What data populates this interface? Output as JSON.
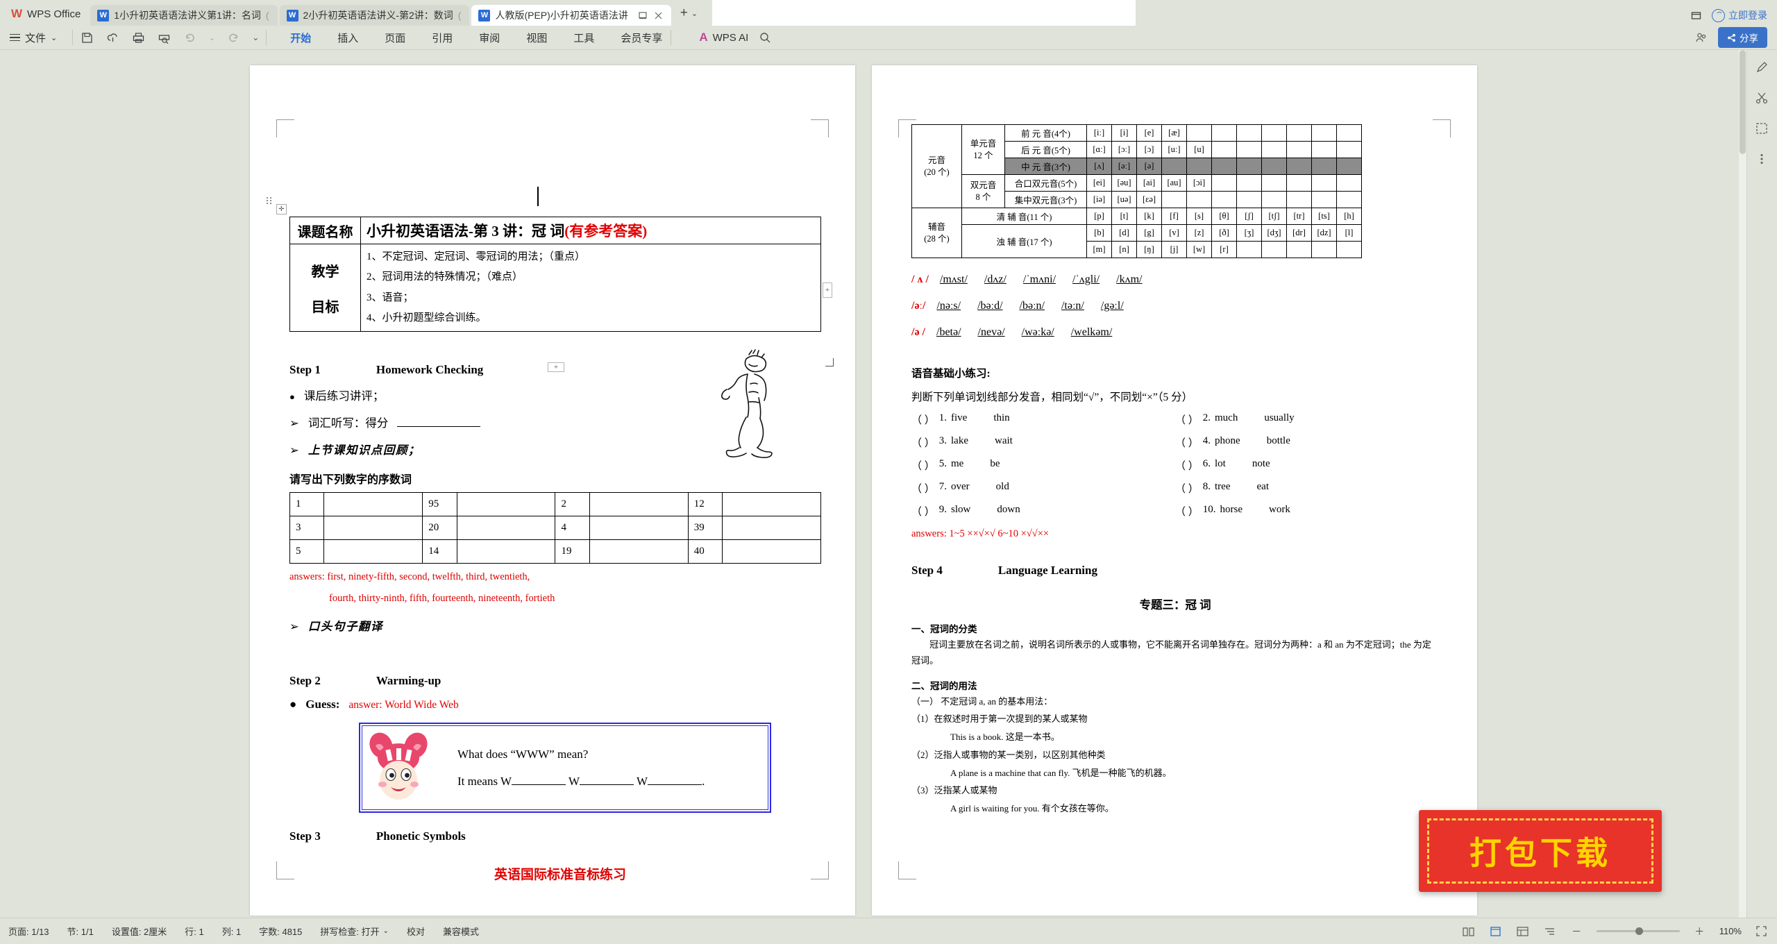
{
  "app": {
    "name": "WPS Office",
    "logo_letter": "W"
  },
  "titlebar": {
    "tabs": [
      {
        "label": "1小升初英语语法讲义第1讲：名词",
        "suffix": "(",
        "active": false
      },
      {
        "label": "2小升初英语语法讲义-第2讲：数词",
        "suffix": "(",
        "active": false
      },
      {
        "label": "人教版(PEP)小升初英语语法讲",
        "suffix": "",
        "active": true
      }
    ],
    "new_tab": "+",
    "new_tab_chevron": "⌄",
    "minimize_icon": "window-restore",
    "login_label": "立即登录"
  },
  "ribbon": {
    "file_menu": "文件",
    "file_chevron": "⌄",
    "quick_icons": [
      "save-icon",
      "cloud-save-icon",
      "print-icon",
      "print-preview-icon",
      "undo-icon",
      "undo-dropdown",
      "redo-icon",
      "quick-access-chevron"
    ],
    "tabs": [
      "开始",
      "插入",
      "页面",
      "引用",
      "审阅",
      "视图",
      "工具",
      "会员专享"
    ],
    "active_tab": "开始",
    "ai_label": "WPS AI",
    "search_icon": "search-icon",
    "share_label": "分享",
    "right_icons": [
      "collaborate-icon",
      "share-icon"
    ]
  },
  "document": {
    "left_page": {
      "title_table": {
        "row1_label": "课题名称",
        "row1_title": "小升初英语语法-第 3 讲：冠 词",
        "row1_title_red": "(有参考答案)",
        "row2_label_line1": "教学",
        "row2_label_line2": "目标",
        "objectives": [
          "1、不定冠词、定冠词、零冠词的用法；（重点）",
          "2、冠词用法的特殊情况；（难点）",
          "3、语音；",
          "4、小升初题型综合训练。"
        ]
      },
      "step1": {
        "label": "Step 1",
        "title": "Homework Checking",
        "bullet1": "课后练习讲评；",
        "arrow1": "词汇听写：得分",
        "arrow2": "上节课知识点回顾；",
        "section_title": "请写出下列数字的序数词",
        "table_rows": [
          [
            "1",
            "",
            "95",
            "",
            "2",
            "",
            "12",
            ""
          ],
          [
            "3",
            "",
            "20",
            "",
            "4",
            "",
            "39",
            ""
          ],
          [
            "5",
            "",
            "14",
            "",
            "19",
            "",
            "40",
            ""
          ]
        ],
        "answers_line1": "answers: first, ninety-fifth, second, twelfth, third, twentieth,",
        "answers_line2": "fourth, thirty-ninth, fifth, fourteenth, nineteenth, fortieth",
        "arrow3": "口头句子翻译"
      },
      "step2": {
        "label": "Step 2",
        "title": "Warming-up",
        "guess_label": "Guess:",
        "guess_answer": "answer: World Wide Web",
        "box_line1": "What does “WWW” mean?",
        "box_line2_pre": "It means W",
        "box_line2_mid1": "W",
        "box_line2_mid2": "W",
        "box_line2_end": "."
      },
      "step3": {
        "label": "Step 3",
        "title": "Phonetic Symbols",
        "red_title": "英语国际标准音标练习"
      }
    },
    "right_page": {
      "phonetic_table": {
        "rows": [
          {
            "group": "元音\n(20 个)",
            "sub": "单元音\n12 个",
            "name": "前  元 音(4个)",
            "cells": [
              "[iː]",
              "[i]",
              "[e]",
              "[æ]",
              "",
              "",
              "",
              "",
              "",
              "",
              ""
            ],
            "shade": false
          },
          {
            "group": "",
            "sub": "",
            "name": "后  元 音(5个)",
            "cells": [
              "[ɑː]",
              "[ɔː]",
              "[ɔ]",
              "[uː]",
              "[u]",
              "",
              "",
              "",
              "",
              "",
              ""
            ],
            "shade": false
          },
          {
            "group": "",
            "sub": "",
            "name": "中  元 音(3个)",
            "cells": [
              "[ʌ]",
              "[əː]",
              "[ə]",
              "",
              "",
              "",
              "",
              "",
              "",
              "",
              ""
            ],
            "shade": true
          },
          {
            "group": "",
            "sub": "双元音\n8 个",
            "name": "合口双元音(5个)",
            "cells": [
              "[ei]",
              "[əu]",
              "[ai]",
              "[au]",
              "[ɔi]",
              "",
              "",
              "",
              "",
              "",
              ""
            ],
            "shade": false
          },
          {
            "group": "",
            "sub": "",
            "name": "集中双元音(3个)",
            "cells": [
              "[iə]",
              "[uə]",
              "[ɛə]",
              "",
              "",
              "",
              "",
              "",
              "",
              "",
              ""
            ],
            "shade": false
          },
          {
            "group": "辅音\n(28 个)",
            "sub": "",
            "name": "清  辅   音(11 个)",
            "cells": [
              "[p]",
              "[t]",
              "[k]",
              "[f]",
              "[s]",
              "[θ]",
              "[ʃ]",
              "[tʃ]",
              "[tr]",
              "[ts]",
              "[h]"
            ],
            "shade": false
          },
          {
            "group": "",
            "sub": "",
            "name": "浊  辅   音(17 个)",
            "cells": [
              "[b]",
              "[d]",
              "[g]",
              "[v]",
              "[z]",
              "[ð]",
              "[ʒ]",
              "[dʒ]",
              "[dr]",
              "[dz]",
              "[l]"
            ],
            "shade": false
          },
          {
            "group": "",
            "sub": "",
            "name": "",
            "cells": [
              "[m]",
              "[n]",
              "[ŋ]",
              "[j]",
              "[w]",
              "[r]",
              "",
              "",
              "",
              "",
              ""
            ],
            "shade": false
          }
        ],
        "labels": {
          "vowel_group": "元音",
          "vowel_count": "(20 个)",
          "mono": "单元音",
          "mono_count": "12 个",
          "diph": "双元音",
          "diph_count": "8 个",
          "cons_group": "辅音",
          "cons_count": "(28 个)"
        }
      },
      "ipa_rows": [
        {
          "key": "/ ʌ /",
          "words": [
            "/mʌst/",
            "/dʌz/",
            "/ˈmʌni/",
            "/ˈʌgli/",
            "/kʌm/"
          ]
        },
        {
          "key": "/əː/",
          "words": [
            "/nəːs/",
            "/bəːd/",
            "/bəːn/",
            "/təːn/",
            "/gəːl/"
          ]
        },
        {
          "key": "/ə /",
          "words": [
            "/betə/",
            "/nevə/",
            "/wəːkə/",
            "/welkəm/"
          ]
        }
      ],
      "practice": {
        "title": "语音基础小练习:",
        "instruction": "判断下列单词划线部分发音，相同划“√”，不同划“×”（5 分）",
        "items": [
          {
            "no": "1.",
            "w1": "five",
            "w1_u": "i",
            "w2": "thin",
            "w2_u": "i"
          },
          {
            "no": "2.",
            "w1": "much",
            "w1_u": "u",
            "w2": "usually",
            "w2_u": "u"
          },
          {
            "no": "3.",
            "w1": "lake",
            "w1_u": "a",
            "w2": "wait",
            "w2_u": "ai"
          },
          {
            "no": "4.",
            "w1": "phone",
            "w1_u": "o",
            "w2": "bottle",
            "w2_u": "o"
          },
          {
            "no": "5.",
            "w1": "me",
            "w1_u": "e",
            "w2": "be",
            "w2_u": "e"
          },
          {
            "no": "6.",
            "w1": "lot",
            "w1_u": "o",
            "w2": "note",
            "w2_u": "o"
          },
          {
            "no": "7.",
            "w1": "over",
            "w1_u": "o",
            "w2": "old",
            "w2_u": "o"
          },
          {
            "no": "8.",
            "w1": "tree",
            "w1_u": "ee",
            "w2": "eat",
            "w2_u": "ea"
          },
          {
            "no": "9.",
            "w1": "slow",
            "w1_u": "ow",
            "w2": "down",
            "w2_u": "ow"
          },
          {
            "no": "10.",
            "w1": "horse",
            "w1_u": "or",
            "w2": "work",
            "w2_u": "or"
          }
        ],
        "answers": "answers: 1~5 ××√×√      6~10 ×√√××",
        "paren": "（    ）"
      },
      "step4": {
        "label": "Step 4",
        "title": "Language Learning",
        "topic": "专题三：冠  词",
        "h1": "一、冠词的分类",
        "p1": "冠词主要放在名词之前，说明名词所表示的人或事物，它不能离开名词单独存在。冠词分为两种：a 和 an 为不定冠词；the 为定冠词。",
        "h2": "二、冠词的用法",
        "h2a": "（一） 不定冠词 a, an 的基本用法：",
        "p2": "（1）在叙述时用于第一次提到的某人或某物",
        "p2e": "This is a book. 这是一本书。",
        "p3": "（2）泛指人或事物的某一类别，以区别其他种类",
        "p3e": "A plane is a machine that can fly. 飞机是一种能飞的机器。",
        "p4": "（3）泛指某人或某物",
        "p4e": "A girl is waiting for you. 有个女孩在等你。"
      }
    }
  },
  "statusbar": {
    "page_label": "页面: 1/13",
    "section_label": "节: 1/1",
    "margin_label": "设置值: 2厘米",
    "row_label": "行: 1",
    "col_label": "列: 1",
    "word_count": "字数: 4815",
    "spellcheck": "拼写检查: 打开",
    "spell_chevron": "⌄",
    "proof": "校对",
    "compat": "兼容模式",
    "zoom_level": "110%",
    "zoom_out": "－",
    "zoom_in": "＋",
    "view_icons": [
      "read-layout-icon",
      "page-layout-icon",
      "web-layout-icon",
      "outline-icon"
    ]
  },
  "download_stamp": {
    "text": "打包下载"
  },
  "colors": {
    "accent": "#2b6cd4",
    "chrome": "#dfe3da",
    "red": "#e00000",
    "stamp_red": "#e8332a",
    "stamp_yellow": "#ffd400",
    "box_blue": "#2a2ae0"
  }
}
